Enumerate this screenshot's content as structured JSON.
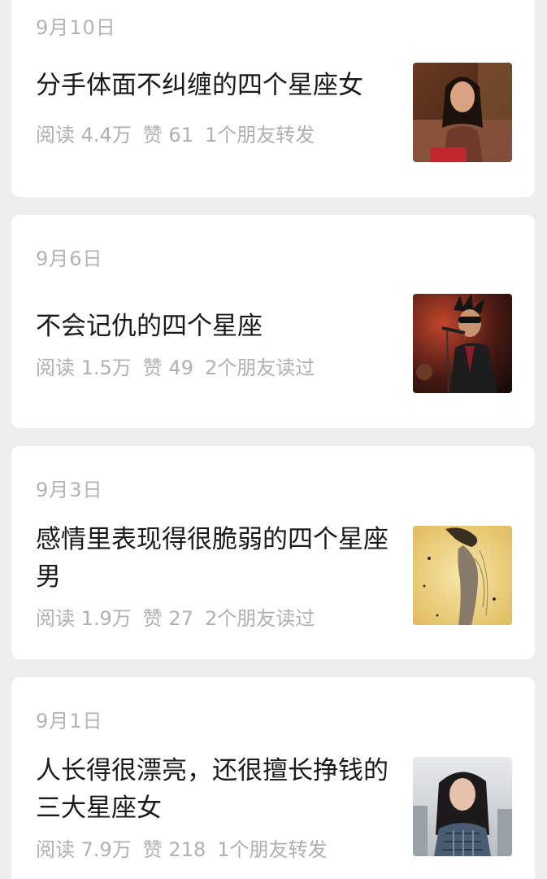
{
  "articles": [
    {
      "date": "9月10日",
      "title": "分手体面不纠缠的四个星座女",
      "reads": "阅读 4.4万",
      "likes": "赞 61",
      "social": "1个朋友转发",
      "thumb_icon": "woman-portrait-image"
    },
    {
      "date": "9月6日",
      "title": "不会记仇的四个星座",
      "reads": "阅读 1.5万",
      "likes": "赞 49",
      "social": "2个朋友读过",
      "thumb_icon": "rock-singer-image"
    },
    {
      "date": "9月3日",
      "title": "感情里表现得很脆弱的四个星座男",
      "reads": "阅读 1.9万",
      "likes": "赞 27",
      "social": "2个朋友读过",
      "thumb_icon": "sad-figure-illustration"
    },
    {
      "date": "9月1日",
      "title": "人长得很漂亮，还很擅长挣钱的三大星座女",
      "reads": "阅读 7.9万",
      "likes": "赞 218",
      "social": "1个朋友转发",
      "thumb_icon": "girl-portrait-image"
    }
  ],
  "colors": {
    "background": "#ededed",
    "card": "#ffffff",
    "title_text": "#1a1a1a",
    "meta_text": "#b0b0b0"
  }
}
